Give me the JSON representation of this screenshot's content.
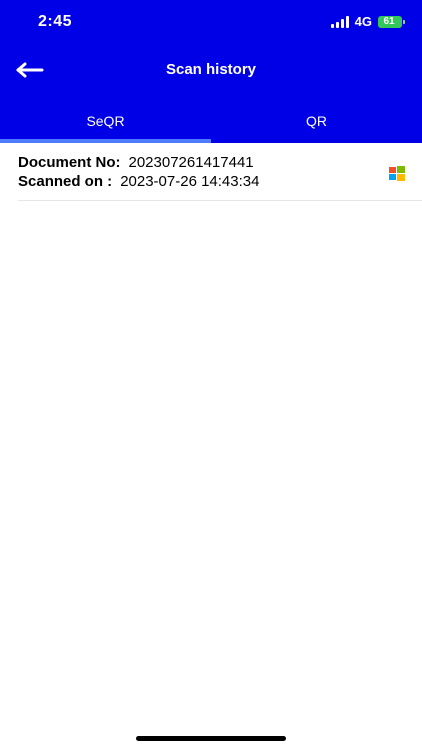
{
  "status_bar": {
    "time": "2:45",
    "network": "4G",
    "battery": "61"
  },
  "header": {
    "title": "Scan history",
    "back_icon": "back-arrow-icon"
  },
  "tabs": [
    {
      "label": "SeQR",
      "selected": true
    },
    {
      "label": "QR",
      "selected": false
    }
  ],
  "history": [
    {
      "document_label": "Document No:",
      "document_no": "202307261417441",
      "scanned_label": "Scanned on :",
      "scanned_on": "2023-07-26 14:43:34",
      "icon": "windows-logo-icon"
    }
  ],
  "colors": {
    "header_bg": "#0000e6",
    "tab_indicator": "#4f7cff",
    "battery": "#34c759"
  }
}
